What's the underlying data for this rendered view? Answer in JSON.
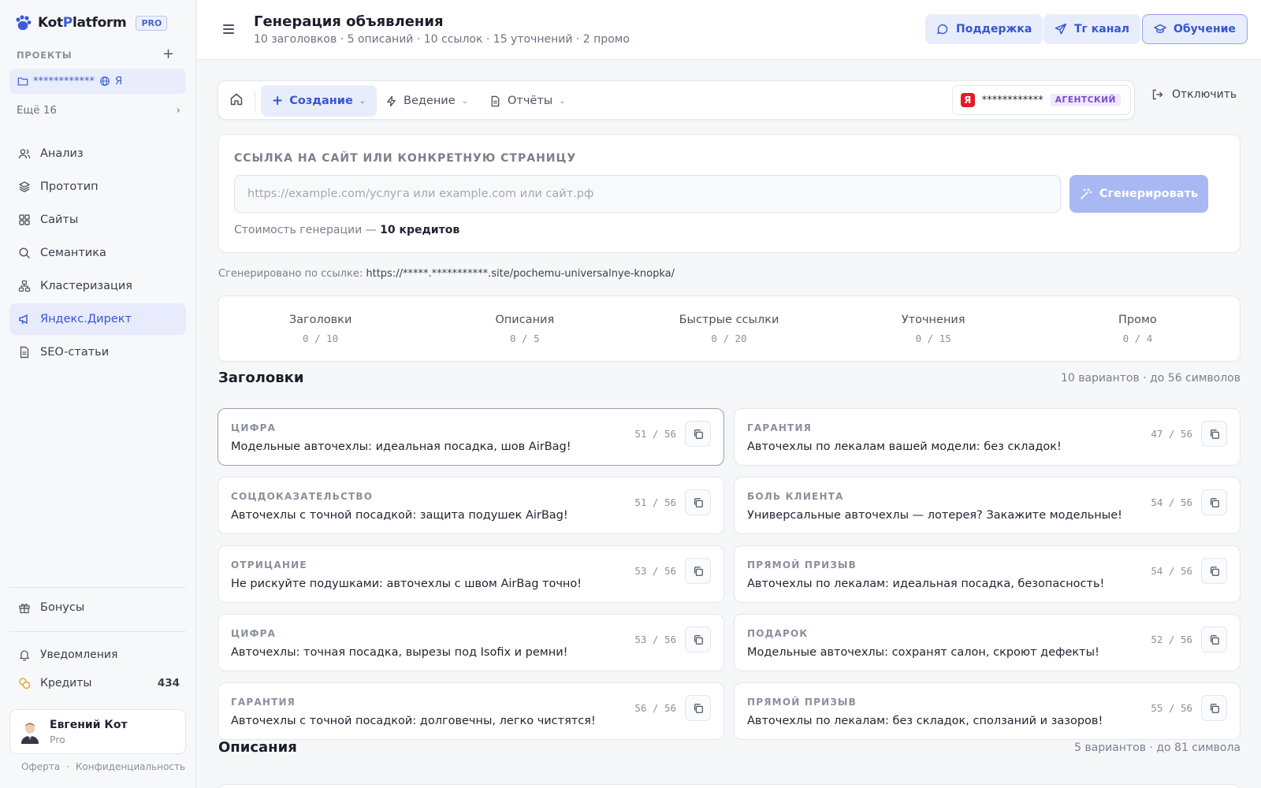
{
  "app": {
    "name_a": "Kot",
    "name_b": "P",
    "name_c": "latform",
    "badge": "PRO"
  },
  "sidebar": {
    "projects_title": "ПРОЕКТЫ",
    "add_icon": "plus-icon",
    "project": {
      "name": "************",
      "suffix": "Я"
    },
    "more": "Ещё 16",
    "items": [
      {
        "label": "Анализ",
        "icon": "users-icon",
        "active": false
      },
      {
        "label": "Прототип",
        "icon": "layers-icon",
        "active": false
      },
      {
        "label": "Сайты",
        "icon": "grid-icon",
        "active": false
      },
      {
        "label": "Семантика",
        "icon": "search-icon",
        "active": false
      },
      {
        "label": "Кластеризация",
        "icon": "cluster-icon",
        "active": false
      },
      {
        "label": "Яндекс.Директ",
        "icon": "megaphone-icon",
        "active": true
      },
      {
        "label": "SEO-статьи",
        "icon": "doc-icon",
        "active": false
      }
    ],
    "bonus": "Бонусы",
    "notifications": "Уведомления",
    "credits_label": "Кредиты",
    "credits_value": "434",
    "user": {
      "name": "Евгений Кот",
      "plan": "Pro"
    },
    "legal": [
      "Оферта",
      "·",
      "Конфиденциальность"
    ]
  },
  "header": {
    "title": "Генерация объявления",
    "subtitle": "10 заголовков · 5 описаний · 10 ссылок · 15 уточнений · 2 промо",
    "support": "Поддержка",
    "tg": "Тг канал",
    "edu": "Обучение"
  },
  "tabs": {
    "create": "Создание",
    "manage": "Ведение",
    "reports": "Отчёты",
    "account_name": "************",
    "account_badge": "АГЕНТСКИЙ",
    "disconnect": "Отключить"
  },
  "generator": {
    "label": "ССЫЛКА НА САЙТ ИЛИ КОНКРЕТНУЮ СТРАНИЦУ",
    "placeholder": "https://example.com/услуга или example.com или сайт.рф",
    "button": "Сгенерировать",
    "cost_prefix": "Стоимость генерации —",
    "cost_value": "10 кредитов"
  },
  "source": {
    "prefix": "Сгенерировано по ссылке:",
    "url": "https://*****.***********.site/pochemu-universalnye-knopka/"
  },
  "stats": [
    {
      "name": "Заголовки",
      "value": "0 / 10"
    },
    {
      "name": "Описания",
      "value": "0 / 5"
    },
    {
      "name": "Быстрые ссылки",
      "value": "0 / 20"
    },
    {
      "name": "Уточнения",
      "value": "0 / 15"
    },
    {
      "name": "Промо",
      "value": "0 / 4"
    }
  ],
  "headlines_section": {
    "title": "Заголовки",
    "meta": "10 вариантов · до 56 символов"
  },
  "headlines": [
    {
      "tag": "ЦИФРА",
      "text": "Модельные авточехлы: идеальная посадка, шов AirBag!",
      "count": "51 / 56"
    },
    {
      "tag": "ГАРАНТИЯ",
      "text": "Авточехлы по лекалам вашей модели: без складок!",
      "count": "47 / 56"
    },
    {
      "tag": "СОЦДОКАЗАТЕЛЬСТВО",
      "text": "Авточехлы с точной посадкой: защита подушек AirBag!",
      "count": "51 / 56"
    },
    {
      "tag": "БОЛЬ КЛИЕНТА",
      "text": "Универсальные авточехлы — лотерея? Закажите модельные!",
      "count": "54 / 56"
    },
    {
      "tag": "ОТРИЦАНИЕ",
      "text": "Не рискуйте подушками: авточехлы с швом AirBag точно!",
      "count": "53 / 56"
    },
    {
      "tag": "ПРЯМОЙ ПРИЗЫВ",
      "text": "Авточехлы по лекалам: идеальная посадка, безопасность!",
      "count": "54 / 56"
    },
    {
      "tag": "ЦИФРА",
      "text": "Авточехлы: точная посадка, вырезы под Isofix и ремни!",
      "count": "53 / 56"
    },
    {
      "tag": "ПОДАРОК",
      "text": "Модельные авточехлы: сохранят салон, скроют дефекты!",
      "count": "52 / 56"
    },
    {
      "tag": "ГАРАНТИЯ",
      "text": "Авточехлы с точной посадкой: долговечны, легко чистятся!",
      "count": "56 / 56"
    },
    {
      "tag": "ПРЯМОЙ ПРИЗЫВ",
      "text": "Авточехлы по лекалам: без складок, сползаний и зазоров!",
      "count": "55 / 56"
    }
  ],
  "descriptions_section": {
    "title": "Описания",
    "meta": "5 вариантов · до 81 символа"
  },
  "colors": {
    "accent": "#3b5bdb",
    "accent_bg": "#e8edfb",
    "yandex": "#e31b23"
  }
}
